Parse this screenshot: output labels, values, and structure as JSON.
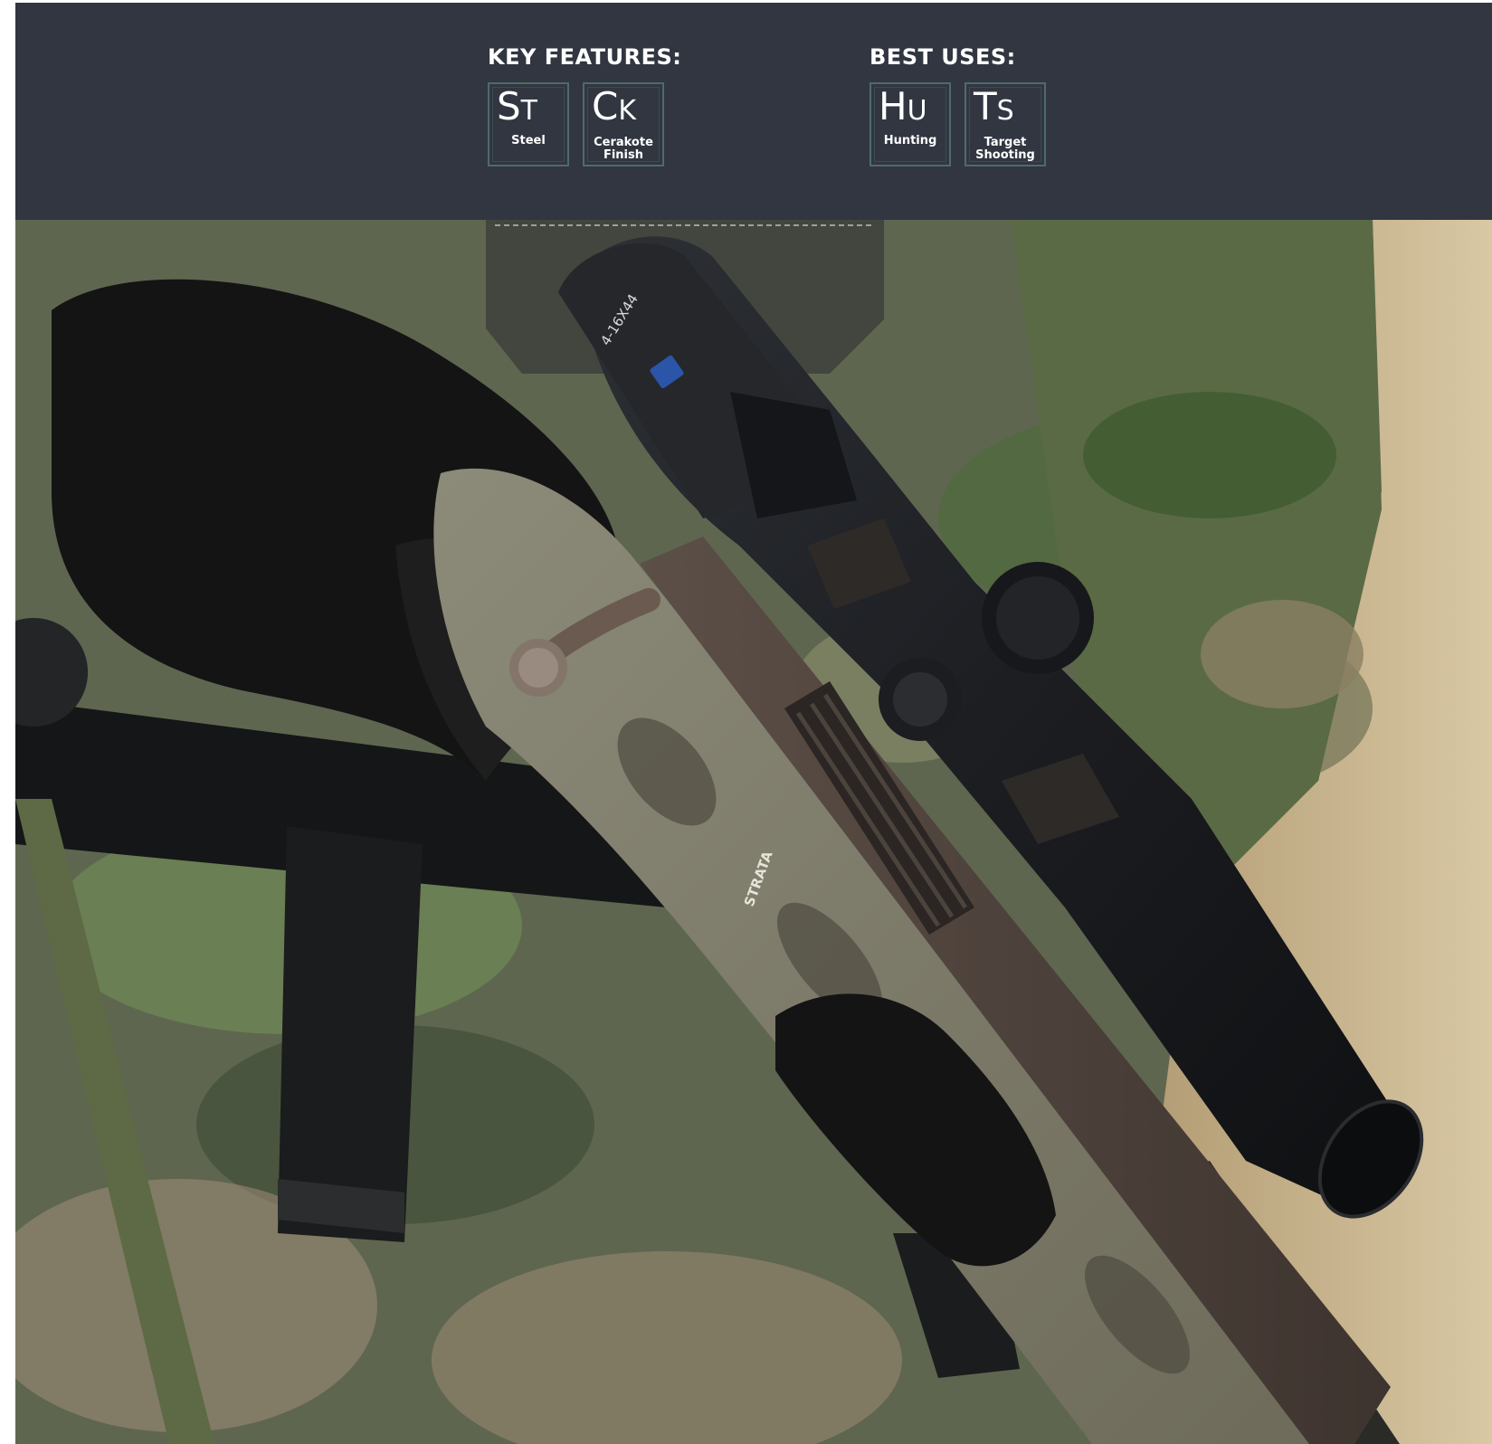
{
  "key_features": {
    "title": "KEY FEATURES:",
    "items": [
      {
        "symbol_big": "S",
        "symbol_small": "T",
        "label": "Steel"
      },
      {
        "symbol_big": "C",
        "symbol_small": "K",
        "label": "Cerakote\nFinish"
      }
    ]
  },
  "best_uses": {
    "title": "BEST USES:",
    "items": [
      {
        "symbol_big": "H",
        "symbol_small": "U",
        "label": "Hunting"
      },
      {
        "symbol_big": "T",
        "symbol_small": "S",
        "label": "Target\nShooting"
      }
    ]
  },
  "photo": {
    "scope_text": "4-16X44",
    "stock_text": "STRATA",
    "colors": {
      "header_bg": "#313641",
      "tile_border": "#4f6a6b"
    }
  }
}
